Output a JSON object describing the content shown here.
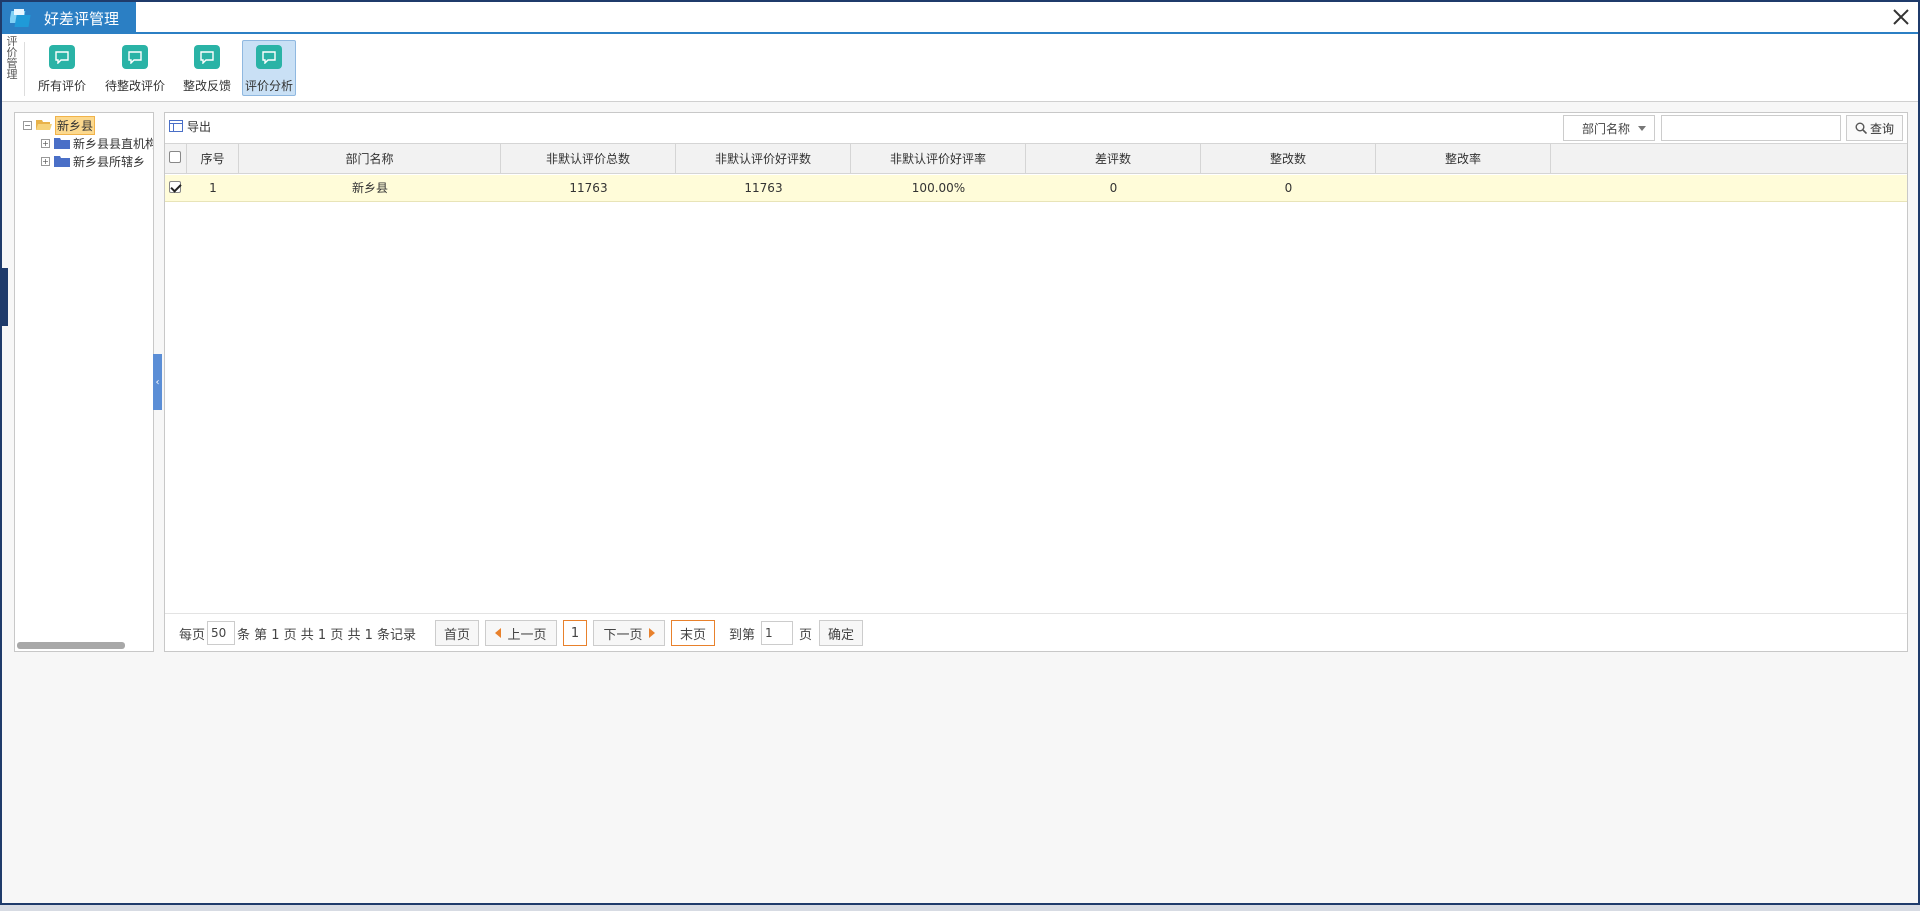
{
  "window": {
    "title": "好差评管理",
    "close_icon": "close-icon"
  },
  "ribbon": {
    "group_label": [
      "评",
      "价",
      "管",
      "理"
    ],
    "buttons": [
      {
        "label": "所有评价",
        "icon": "comment-icon",
        "active": false
      },
      {
        "label": "待整改评价",
        "icon": "comment-icon",
        "active": false
      },
      {
        "label": "整改反馈",
        "icon": "comment-icon",
        "active": false
      },
      {
        "label": "评价分析",
        "icon": "comment-icon",
        "active": true
      }
    ]
  },
  "tree": {
    "root": {
      "label": "新乡县",
      "expanded": true,
      "selected": true
    },
    "children": [
      {
        "label": "新乡县县直机构",
        "expanded": false
      },
      {
        "label": "新乡县所辖乡",
        "expanded": false
      }
    ]
  },
  "toolbar": {
    "export_label": "导出",
    "search_field": "部门名称",
    "search_value": "",
    "search_button": "查询"
  },
  "table": {
    "columns": [
      "序号",
      "部门名称",
      "非默认评价总数",
      "非默认评价好评数",
      "非默认评价好评率",
      "差评数",
      "整改数",
      "整改率"
    ],
    "rows": [
      {
        "checked": true,
        "cells": [
          "1",
          "新乡县",
          "11763",
          "11763",
          "100.00%",
          "0",
          "0",
          ""
        ]
      }
    ]
  },
  "pager": {
    "per_page_label": "每页",
    "per_page_value": "50",
    "summary": "条 第 1 页 共 1 页 共 1 条记录",
    "first": "首页",
    "prev": "上一页",
    "current": "1",
    "next": "下一页",
    "last": "末页",
    "goto_label": "到第",
    "goto_value": "1",
    "page_unit": "页",
    "confirm": "确定"
  },
  "colors": {
    "accent": "#2b7fc4",
    "ribbon_icon": "#2ab3a6",
    "row_highlight": "#fffcd9",
    "pager_highlight": "#e8812c"
  }
}
